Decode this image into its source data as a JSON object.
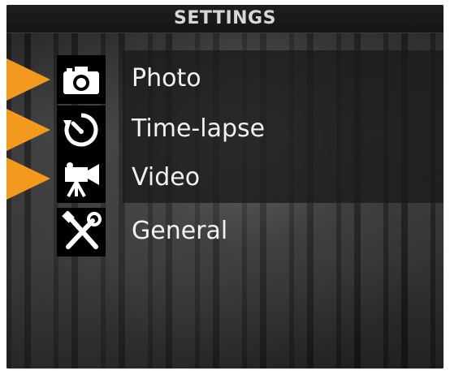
{
  "header": {
    "title": "SETTINGS"
  },
  "menu": {
    "accent_color": "#F39A1E",
    "items": [
      {
        "label": "Photo",
        "icon": "camera-icon",
        "selected": true
      },
      {
        "label": "Time-lapse",
        "icon": "timelapse-icon",
        "selected": true
      },
      {
        "label": "Video",
        "icon": "video-camera-icon",
        "selected": true
      },
      {
        "label": "General",
        "icon": "tools-icon",
        "selected": false
      }
    ]
  }
}
